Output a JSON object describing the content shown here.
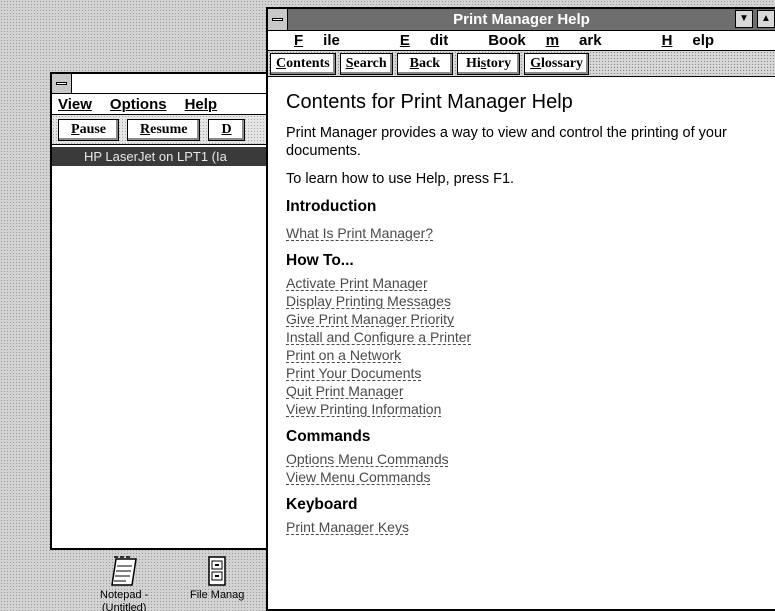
{
  "print_manager": {
    "menu": [
      "View",
      "Options",
      "Help"
    ],
    "buttons": [
      {
        "first": "P",
        "rest": "ause"
      },
      {
        "first": "R",
        "rest": "esume"
      },
      {
        "first": "D",
        "rest": ""
      }
    ],
    "queue_row": "HP LaserJet on LPT1 (Ia"
  },
  "desktop_icons": [
    {
      "label_line1": "Notepad -",
      "label_line2": "(Untitled)",
      "icon": "notepad-icon"
    },
    {
      "label_line1": "File Manag",
      "label_line2": "",
      "icon": "file-manager-icon"
    }
  ],
  "help": {
    "title": "Print Manager Help",
    "menu": [
      {
        "pre": "",
        "ul": "F",
        "post": "ile"
      },
      {
        "pre": "",
        "ul": "E",
        "post": "dit"
      },
      {
        "pre": "Book",
        "ul": "m",
        "post": "ark"
      },
      {
        "pre": "",
        "ul": "H",
        "post": "elp"
      }
    ],
    "buttons": [
      {
        "ul": "C",
        "rest": "ontents"
      },
      {
        "ul": "S",
        "rest": "earch"
      },
      {
        "ul": "B",
        "rest": "ack"
      },
      {
        "ul": "",
        "pre": "Hi",
        "mid": "s",
        "rest": "tory"
      },
      {
        "ul": "G",
        "rest": "lossary"
      }
    ],
    "heading": "Contents for Print Manager Help",
    "intro_text": "Print Manager provides a way to view and control the printing of your documents.",
    "f1_text": "To learn how to use Help, press F1.",
    "sections": [
      {
        "title": "Introduction",
        "links": [
          "What Is Print Manager?"
        ]
      },
      {
        "title": "How To...",
        "links": [
          "Activate Print Manager",
          "Display Printing Messages",
          "Give Print Manager Priority",
          "Install and Configure a Printer",
          "Print on a Network",
          "Print Your Documents",
          "Quit Print Manager",
          "View Printing Information"
        ]
      },
      {
        "title": "Commands",
        "links": [
          "Options Menu Commands",
          "View Menu Commands"
        ]
      },
      {
        "title": "Keyboard",
        "links": [
          "Print Manager Keys"
        ]
      }
    ]
  }
}
